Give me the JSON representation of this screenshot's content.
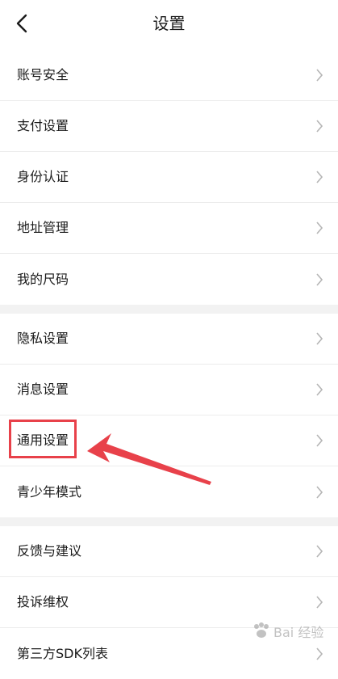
{
  "header": {
    "title": "设置"
  },
  "groups": [
    {
      "items": [
        {
          "label": "账号安全"
        },
        {
          "label": "支付设置"
        },
        {
          "label": "身份认证"
        },
        {
          "label": "地址管理"
        },
        {
          "label": "我的尺码"
        }
      ]
    },
    {
      "items": [
        {
          "label": "隐私设置"
        },
        {
          "label": "消息设置"
        },
        {
          "label": "通用设置"
        },
        {
          "label": "青少年模式"
        }
      ]
    },
    {
      "items": [
        {
          "label": "反馈与建议"
        },
        {
          "label": "投诉维权"
        },
        {
          "label": "第三方SDK列表"
        }
      ]
    }
  ],
  "annotation": {
    "color": "#e8414a",
    "highlighted_item": "通用设置"
  },
  "watermark": {
    "text": "Bai 经验"
  }
}
